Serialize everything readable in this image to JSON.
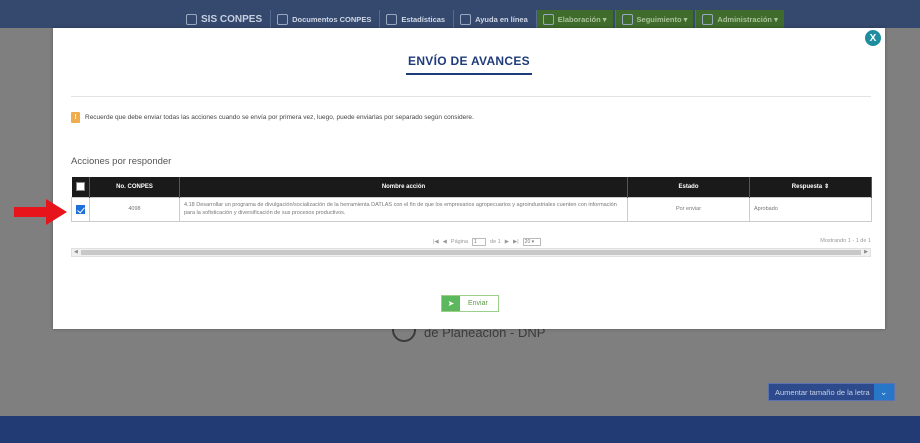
{
  "nav": {
    "logo": "SIS CONPES",
    "items": [
      "Documentos CONPES",
      "Estadísticas",
      "Ayuda en línea",
      "Elaboración ▾",
      "Seguimiento ▾",
      "Administración ▾"
    ]
  },
  "background": {
    "org_text": "de Planeación - DNP",
    "font_button": "Aumentar tamaño de la letra"
  },
  "modal": {
    "close_label": "X",
    "title": "ENVÍO DE AVANCES",
    "notice_icon": "!",
    "notice": "Recuerde que debe enviar todas las acciones cuando se envía por primera vez, luego, puede enviarlas por separado según considere.",
    "section_label": "Acciones por responder",
    "table": {
      "headers": [
        "No. CONPES",
        "Nombre acción",
        "Estado",
        "Respuesta"
      ],
      "rows": [
        {
          "conpes": "4098",
          "accion": "4.18 Desarrollar un programa de divulgación/socialización de la herramienta DATLAS con el fin de que los empresarios agropecuarios y agroindustriales cuenten con información para la sofisticación y diversificación de sus procesos productivos.",
          "estado": "Por enviar",
          "respuesta": "Aprobado"
        }
      ]
    },
    "pager": {
      "page_label": "Página",
      "page_value": "1",
      "of_label": "de 1",
      "page_size": "20",
      "summary": "Mostrando 1 - 1 de 1"
    },
    "send_label": "Enviar"
  },
  "colors": {
    "accent": "#1f3c7a",
    "arrow": "#e8141b",
    "send": "#5cb85c"
  }
}
